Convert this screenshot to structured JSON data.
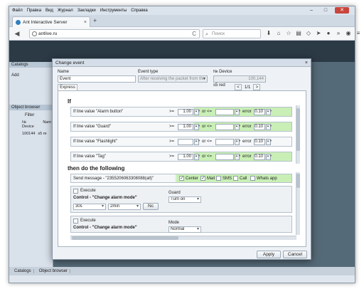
{
  "menu": [
    "Файл",
    "Правка",
    "Вид",
    "Журнал",
    "Закладки",
    "Инструменты",
    "Справка"
  ],
  "tab": {
    "title": "Ant Interactive Server",
    "close": "×",
    "new": "+"
  },
  "nav": {
    "url": "antlive.ru",
    "reload": "C",
    "search_placeholder": "Поиск"
  },
  "app": {
    "panel_title": "Catalogs",
    "add_label": "Add",
    "object_browser": "Object browser",
    "filter_label": "Filter",
    "col_device": "№ Device",
    "col_name": "Nam",
    "row_device": "100144",
    "row_name": "s5 re",
    "status": [
      "Catalogs",
      "Object browser"
    ]
  },
  "dialog": {
    "title": "Change event",
    "close": "×",
    "name_label": "Name",
    "name_value": "Event",
    "event_type_label": "Event type",
    "event_type_value": "After receiving the packet from the",
    "device_label": "№ Device",
    "device_value": "100,144",
    "device_sub": "s5 red",
    "tab_label": "Express",
    "pager": {
      "prev": "<",
      "text": "1/1",
      "next": ">"
    },
    "if_label": "If",
    "conditions": [
      {
        "text": "If line value \"Alarm button\"",
        "ge": ">=",
        "v1": "1.00",
        "le": "or <=",
        "v2": "",
        "err": "error",
        "ev": "0.10",
        "active": true
      },
      {
        "text": "If line value \"Guard\"",
        "ge": ">=",
        "v1": "1.00",
        "le": "or <=",
        "v2": "",
        "err": "error",
        "ev": "0.10",
        "active": true
      },
      {
        "text": "If line value \"Flashlight\"",
        "ge": ">=",
        "v1": "",
        "le": "or <=",
        "v2": "",
        "err": "error",
        "ev": "0.10",
        "active": false
      },
      {
        "text": "If line value \"Tag\"",
        "ge": ">=",
        "v1": "1.00",
        "le": "or <=",
        "v2": "",
        "err": "error",
        "ev": "0.10",
        "active": true
      }
    ],
    "then_label": "then do the following",
    "send_message": "Send message - \"2355206063308088(all)\"",
    "channels": [
      {
        "label": "Center",
        "checked": true
      },
      {
        "label": "Mail",
        "checked": true
      },
      {
        "label": "SMS",
        "checked": false
      },
      {
        "label": "Call",
        "checked": false
      },
      {
        "label": "Whats app",
        "checked": false
      }
    ],
    "actions": [
      {
        "execute": "Execute",
        "control": "Control - \"Change alarm mode\"",
        "param_label": "Guard",
        "param_value": "Turn on",
        "t1": "30s",
        "t2": "2min",
        "no": "Nc"
      },
      {
        "execute": "Execute",
        "control": "Control - \"Change alarm mode\"",
        "param_label": "Mode",
        "param_value": "Normal"
      }
    ],
    "apply": "Apply",
    "cancel": "Cancel"
  }
}
